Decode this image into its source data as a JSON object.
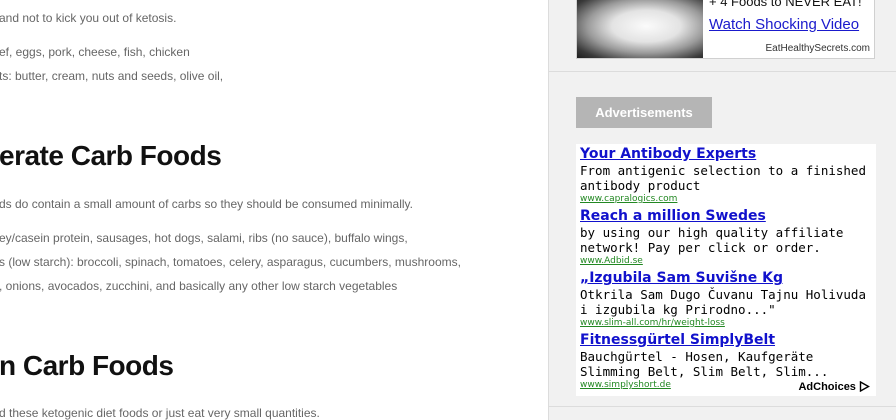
{
  "article": {
    "lines_top": [
      "and not to kick you out of ketosis.",
      "ef, eggs, pork, cheese, fish, chicken",
      "ts: butter, cream, nuts and seeds, olive oil,"
    ],
    "heading_moderate": "erate Carb Foods",
    "moderate_intro": "ds do contain a small amount of carbs so they should be consumed minimally.",
    "moderate_lines": [
      "ey/casein protein, sausages, hot dogs, salami, ribs (no sauce), buffalo wings,",
      "s (low starch): broccoli, spinach, tomatoes, celery, asparagus, cucumbers, mushrooms,",
      ", onions, avocados, zucchini, and basically any other low starch vegetables"
    ],
    "heading_high": "n Carb Foods",
    "high_intro": "d these ketogenic diet foods or just eat very small quantities."
  },
  "sidebar": {
    "promo": {
      "top_text": "+ 4 Foods to NEVER EAT!",
      "link": "Watch Shocking Video",
      "source": "EatHealthySecrets.com"
    },
    "ad_label": "Advertisements",
    "ads": [
      {
        "title": "Your Antibody Experts",
        "text": "From antigenic selection to a finished antibody product",
        "url": "www.capralogics.com"
      },
      {
        "title": "Reach a million Swedes",
        "text": "by using our high quality affiliate network! Pay per click or order.",
        "url": "www.Adbid.se"
      },
      {
        "title": "„Izgubila Sam Suvišne Kg",
        "text": "Otkrila Sam Dugo Čuvanu Tajnu Holivuda i izgubila kg Prirodno...\"",
        "url": "www.slim-all.com/hr/weight-loss"
      },
      {
        "title": "Fitnessgürtel SimplyBelt",
        "text": "Bauchgürtel - Hosen, Kaufgeräte Slimming Belt, Slim Belt, Slim...",
        "url": "www.simplyshort.de"
      }
    ],
    "adchoices": "AdChoices",
    "adchoices_icon": "adchoices-triangle-icon"
  }
}
